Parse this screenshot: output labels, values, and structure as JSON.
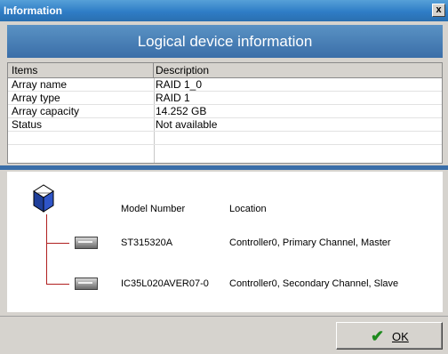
{
  "window": {
    "title": "Information",
    "close_glyph": "x"
  },
  "banner": {
    "text": "Logical device information"
  },
  "table": {
    "headers": [
      "Items",
      "Description"
    ],
    "rows": [
      {
        "item": "Array name",
        "description": "RAID 1_0"
      },
      {
        "item": "Array type",
        "description": "RAID 1"
      },
      {
        "item": "Array capacity",
        "description": "14.252 GB"
      },
      {
        "item": "Status",
        "description": "Not available"
      }
    ]
  },
  "devices": {
    "header_model": "Model Number",
    "header_location": "Location",
    "array_icon": "array-cube-icon",
    "items": [
      {
        "model": "ST315320A",
        "location": "Controller0, Primary Channel, Master",
        "icon": "hard-drive-icon"
      },
      {
        "model": "IC35L020AVER07-0",
        "location": "Controller0, Secondary Channel, Slave",
        "icon": "hard-drive-icon"
      }
    ]
  },
  "footer": {
    "ok_label": "OK",
    "ok_icon": "checkmark-icon"
  },
  "colors": {
    "titlebar": "#2f7dc6",
    "banner": "#3a6ea8",
    "tree_line": "#b02020",
    "ok_check": "#1e8a1e"
  }
}
